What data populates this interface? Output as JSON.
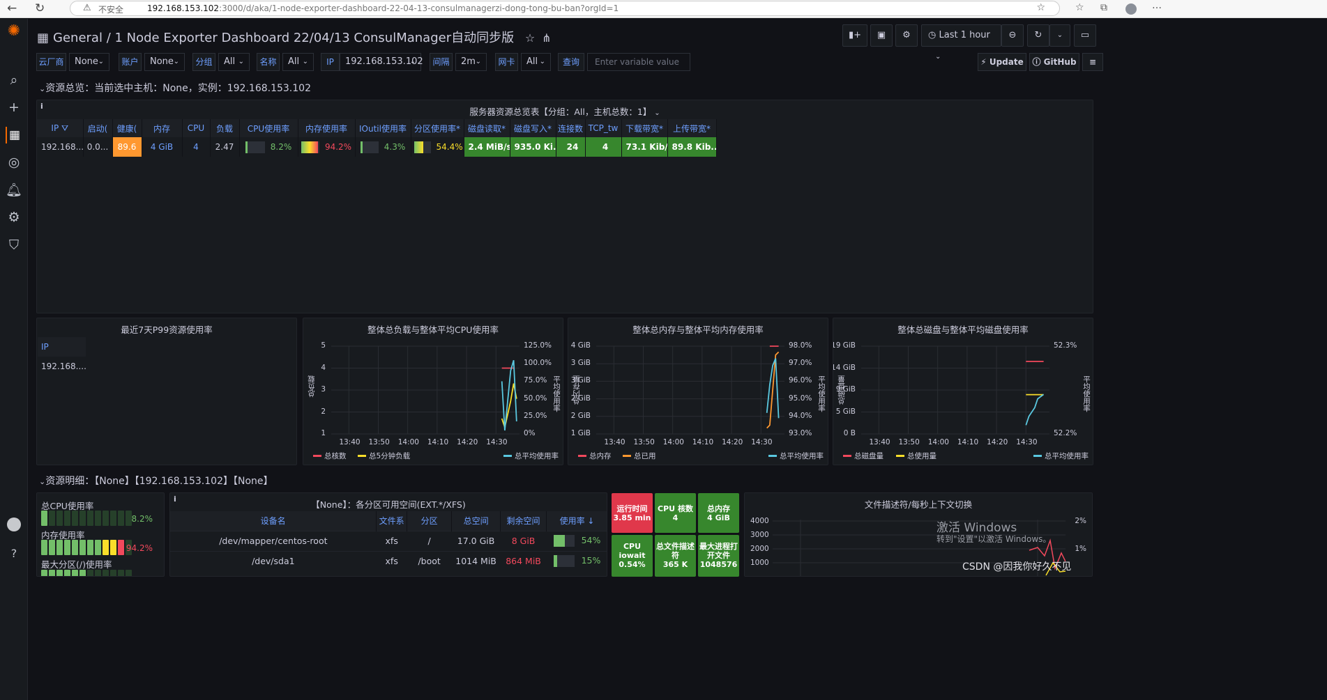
{
  "browser": {
    "insecure": "不安全",
    "host": "192.168.153.102",
    "path": ":3000/d/aka/1-node-exporter-dashboard-22-04-13-consulmanagerzi-dong-tong-bu-ban?orgId=1"
  },
  "breadcrumb": {
    "folder": "General",
    "title": "1 Node Exporter Dashboard 22/04/13 ConsulManager自动同步版"
  },
  "toolbar": {
    "time_range": "Last 1 hour"
  },
  "vars": [
    {
      "label": "云厂商",
      "value": "None"
    },
    {
      "label": "账户",
      "value": "None"
    },
    {
      "label": "分组",
      "value": "All"
    },
    {
      "label": "名称",
      "value": "All"
    },
    {
      "label": "IP",
      "value": "192.168.153.102"
    },
    {
      "label": "间隔",
      "value": "2m"
    },
    {
      "label": "网卡",
      "value": "All"
    }
  ],
  "query": {
    "label": "查询",
    "placeholder": "Enter variable value"
  },
  "update_label": "Update",
  "github_label": "GitHub",
  "row1": "资源总览：当前选中主机：None，实例：192.168.153.102",
  "row2": "资源明细：【None】【192.168.153.102】【None】",
  "overview": {
    "title": "服务器资源总览表【分组：All，主机总数：1】",
    "headers": [
      "IP",
      "启动(",
      "健康(",
      "内存",
      "CPU",
      "负载",
      "CPU使用率",
      "内存使用率",
      "IOutil使用率",
      "分区使用率*",
      "磁盘读取*",
      "磁盘写入*",
      "连接数",
      "TCP_tw",
      "下载带宽*",
      "上传带宽*"
    ],
    "row": {
      "ip": "192.168....",
      "uptime": "0.0...",
      "health": "89.6",
      "mem": "4 GiB",
      "cpu": "4",
      "load": "2.47",
      "cpu_pct": "8.2%",
      "mem_pct": "94.2%",
      "io_pct": "4.3%",
      "part_pct": "54.4%",
      "disk_read": "2.4 MiB/s",
      "disk_write": "935.0 Ki...",
      "conn": "24",
      "tcp_tw": "4",
      "down": "73.1 Kib/s",
      "up": "89.8 Kib..."
    },
    "levels": {
      "cpu": 0.082,
      "mem": 0.942,
      "io": 0.043,
      "part": 0.544
    },
    "colors": {
      "health": "#ff9830",
      "green": "#37872d",
      "red": "#f2495c",
      "orange": "#ff9830",
      "yellow": "#fade2a",
      "blue": "#6e9fff"
    }
  },
  "p99": {
    "title": "最近7天P99资源使用率",
    "header": "IP",
    "value": "192.168...."
  },
  "charts": [
    {
      "title": "整体总负载与整体平均CPU使用率",
      "left_ticks": [
        "5",
        "4",
        "3",
        "2",
        "1"
      ],
      "right_ticks": [
        "125.0%",
        "100.0%",
        "75.0%",
        "50.0%",
        "25.0%",
        "0%"
      ],
      "x_ticks": [
        "13:40",
        "13:50",
        "14:00",
        "14:10",
        "14:20",
        "14:30"
      ],
      "ylabel": "总负载",
      "y2label": "平均使用率",
      "legend_left": [
        {
          "name": "总核数",
          "color": "#f2495c"
        },
        {
          "name": "总5分钟负载",
          "color": "#fade2a"
        }
      ],
      "legend_right": [
        {
          "name": "总平均使用率",
          "color": "#5ac8e0"
        }
      ],
      "series": [
        {
          "name": "总核数",
          "axis": "left",
          "color": "#f2495c",
          "x": [
            "14:32",
            "14:36"
          ],
          "y": [
            4,
            4
          ]
        },
        {
          "name": "总5分钟负载",
          "axis": "left",
          "color": "#fade2a",
          "x": [
            "14:32",
            "14:33",
            "14:35",
            "14:36",
            "14:37"
          ],
          "y": [
            1.7,
            1.3,
            2.5,
            3.3,
            2.6
          ]
        },
        {
          "name": "总平均使用率",
          "axis": "right",
          "color": "#5ac8e0",
          "x": [
            "14:32",
            "14:33",
            "14:35",
            "14:36",
            "14:37"
          ],
          "y": [
            75,
            5,
            90,
            105,
            18
          ]
        }
      ],
      "ylim": [
        1,
        5
      ],
      "y2lim": [
        0,
        125
      ]
    },
    {
      "title": "整体总内存与整体平均内存使用率",
      "left_ticks": [
        "4 GiB",
        "3 GiB",
        "3 GiB",
        "2 GiB",
        "2 GiB",
        "1 GiB"
      ],
      "right_ticks": [
        "98.0%",
        "97.0%",
        "96.0%",
        "95.0%",
        "94.0%",
        "93.0%"
      ],
      "x_ticks": [
        "13:40",
        "13:50",
        "14:00",
        "14:10",
        "14:20",
        "14:30"
      ],
      "ylabel": "总内存量",
      "y2label": "平均使用率",
      "legend_left": [
        {
          "name": "总内存",
          "color": "#f2495c"
        },
        {
          "name": "总已用",
          "color": "#ff9830"
        }
      ],
      "legend_right": [
        {
          "name": "总平均使用率",
          "color": "#5ac8e0"
        }
      ],
      "series": [
        {
          "name": "总内存",
          "axis": "left",
          "color": "#f2495c",
          "x": [
            "14:33",
            "14:36"
          ],
          "y": [
            4,
            4
          ]
        },
        {
          "name": "总已用",
          "axis": "left",
          "color": "#ff9830",
          "x": [
            "14:32",
            "14:33",
            "14:34",
            "14:35",
            "14:36"
          ],
          "y": [
            1.2,
            1.3,
            2.5,
            3.7,
            3.8
          ]
        },
        {
          "name": "总平均使用率",
          "axis": "right",
          "color": "#5ac8e0",
          "x": [
            "14:32",
            "14:33",
            "14:34",
            "14:35",
            "14:36"
          ],
          "y": [
            94.2,
            95.8,
            96.9,
            97.3,
            93.9
          ]
        }
      ],
      "ylim": [
        1,
        4
      ],
      "y2lim": [
        93,
        98
      ]
    },
    {
      "title": "整体总磁盘与整体平均磁盘使用率",
      "left_ticks": [
        "19 GiB",
        "14 GiB",
        "9 GiB",
        "5 GiB",
        "0 B"
      ],
      "right_ticks": [
        "52.3%",
        "52.2%"
      ],
      "x_ticks": [
        "13:40",
        "13:50",
        "14:00",
        "14:10",
        "14:20",
        "14:30"
      ],
      "ylabel": "总磁盘量",
      "y2label": "平均使用率",
      "legend_left": [
        {
          "name": "总磁盘量",
          "color": "#f2495c"
        },
        {
          "name": "总使用量",
          "color": "#fade2a"
        }
      ],
      "legend_right": [
        {
          "name": "总平均使用率",
          "color": "#5ac8e0"
        }
      ],
      "series": [
        {
          "name": "总磁盘量",
          "axis": "left",
          "color": "#f2495c",
          "x": [
            "14:30",
            "14:36"
          ],
          "y": [
            19,
            19
          ]
        },
        {
          "name": "总使用量",
          "axis": "left",
          "color": "#fade2a",
          "x": [
            "14:30",
            "14:36"
          ],
          "y": [
            10.3,
            10.3
          ]
        },
        {
          "name": "总平均使用率",
          "axis": "right",
          "color": "#5ac8e0",
          "x": [
            "14:30",
            "14:31",
            "14:33",
            "14:34",
            "14:36"
          ],
          "y": [
            52.21,
            52.22,
            52.23,
            52.24,
            52.245
          ]
        }
      ],
      "ylim": [
        0,
        23
      ],
      "y2lim": [
        52.2,
        52.3
      ]
    }
  ],
  "summary": {
    "cpu_label": "总CPU使用率",
    "cpu_value": "8.2%",
    "cpu_level": 0.082,
    "mem_label": "内存使用率",
    "mem_value": "94.2%",
    "mem_level": 0.942,
    "part_label": "最大分区(/)使用率"
  },
  "partitions": {
    "title": "【None】：各分区可用空间(EXT.*/XFS)",
    "headers": [
      "设备名",
      "文件系",
      "分区",
      "总空间",
      "剩余空间",
      "使用率"
    ],
    "rows": [
      {
        "dev": "/dev/mapper/centos-root",
        "fs": "xfs",
        "mount": "/",
        "total": "17.0 GiB",
        "free": "8 GiB",
        "pct": "54%",
        "level": 0.54
      },
      {
        "dev": "/dev/sda1",
        "fs": "xfs",
        "mount": "/boot",
        "total": "1014 MiB",
        "free": "864 MiB",
        "pct": "15%",
        "level": 0.15
      }
    ]
  },
  "stats": [
    {
      "label": "运行时间",
      "value": "3.85 min",
      "color": "#e0384b"
    },
    {
      "label": "CPU 核数",
      "value": "4",
      "color": "#37872d"
    },
    {
      "label": "总内存",
      "value": "4 GiB",
      "color": "#37872d"
    },
    {
      "label": "CPU iowait",
      "value": "0.54%",
      "color": "#37872d"
    },
    {
      "label": "总文件描述符",
      "value": "365 K",
      "color": "#37872d"
    },
    {
      "label": "最大进程打开文件",
      "value": "1048576",
      "color": "#37872d"
    }
  ],
  "fd_panel": {
    "title": "文件描述符/每秒上下文切换",
    "left_ticks": [
      "4000",
      "3000",
      "2000",
      "1000"
    ],
    "right_ticks": [
      "2%",
      "1%"
    ]
  },
  "watermark": {
    "line1": "激活 Windows",
    "line2": "转到\"设置\"以激活 Windows。",
    "csdn": "CSDN @因我你好久不见"
  }
}
